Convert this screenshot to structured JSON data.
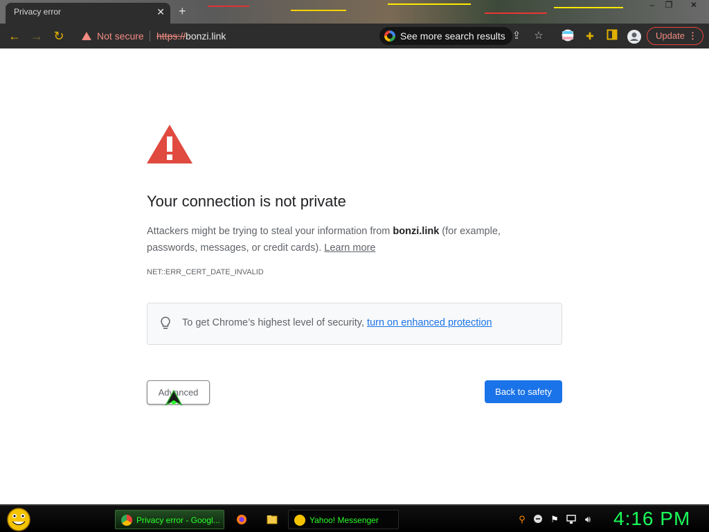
{
  "tab": {
    "title": "Privacy error",
    "close": "✕",
    "new_tab": "+"
  },
  "window": {
    "minimize": "–",
    "restore": "❐",
    "close": "✕"
  },
  "toolbar": {
    "back": "←",
    "forward": "→",
    "reload": "↻",
    "security_label": "Not secure",
    "url_scheme": "https://",
    "url_host": "bonzi.link",
    "search_chip": "See more search results",
    "update_label": "Update",
    "menu": "⋮"
  },
  "page": {
    "heading": "Your connection is not private",
    "desc_prefix": "Attackers might be trying to steal your information from ",
    "desc_host": "bonzi.link",
    "desc_suffix": " (for example, passwords, messages, or credit cards). ",
    "learn_more": "Learn more",
    "error_code": "NET::ERR_CERT_DATE_INVALID",
    "info_text": "To get Chrome’s highest level of security, ",
    "info_link": "turn on enhanced protection",
    "advanced_button": "Advanced",
    "safety_button": "Back to safety"
  },
  "taskbar": {
    "tasks": [
      {
        "label": "Privacy error - Googl..."
      },
      {
        "label": "Yahoo! Messenger"
      }
    ],
    "clock": "4:16 PM"
  },
  "colors": {
    "accent_blue": "#1a73e8",
    "warning_red": "#e04a3f",
    "insecure_red": "#f28b82",
    "taskbar_green": "#1aff5a"
  }
}
